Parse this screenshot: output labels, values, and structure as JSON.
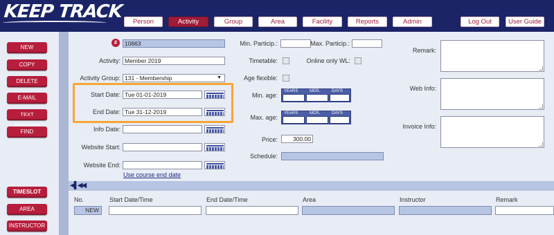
{
  "header": {
    "logo": "KEEP TRACK",
    "nav": [
      {
        "label": "Person"
      },
      {
        "label": "Activity",
        "active": true
      },
      {
        "label": "Group"
      },
      {
        "label": "Area"
      },
      {
        "label": "Facility"
      },
      {
        "label": "Reports"
      },
      {
        "label": "Admin"
      }
    ],
    "logout": "Log Out",
    "user_guide": "User Guide"
  },
  "sidebar": {
    "top": [
      "NEW",
      "COPY",
      "DELETE",
      "E-MAIL",
      "TEXT MESSAGE",
      "FIND"
    ],
    "bottom": [
      "TIMESLOT",
      "AREA",
      "INSTRUCTOR"
    ]
  },
  "form": {
    "id_value": "10663",
    "hash_symbol": "#",
    "activity_label": "Activity:",
    "activity_value": "Member 2019",
    "group_label": "Activity Group:",
    "group_value": "131 - Membership",
    "start_label": "Start Date:",
    "start_value": "Tue 01-01-2019",
    "end_label": "End Date:",
    "end_value": "Tue 31-12-2019",
    "info_label": "Info Date:",
    "web_start_label": "Website Start:",
    "web_end_label": "Website End:",
    "course_end_link": "Use course end date",
    "min_particip_label": "Min. Particip.:",
    "max_particip_label": "Max. Particip.:",
    "timetable_label": "Timetable:",
    "online_wl_label": "Online only WL:",
    "age_flexible_label": "Age flexible:",
    "min_age_label": "Min. age:",
    "max_age_label": "Max. age:",
    "age_cols": [
      "YEARS",
      "MOS.",
      "DAYS"
    ],
    "price_label": "Price:",
    "price_value": "300.00",
    "schedule_label": "Schedule:",
    "remark_label": "Remark:",
    "web_info_label": "Web Info:",
    "invoice_info_label": "Invoice Info:"
  },
  "table": {
    "columns": [
      "No.",
      "Start Date/Time",
      "End Date/Time",
      "Area",
      "Instructor",
      "Remark"
    ],
    "new_button": "NEW"
  }
}
